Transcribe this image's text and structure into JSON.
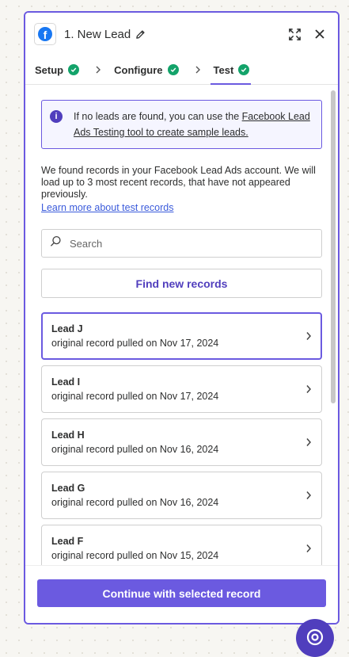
{
  "header": {
    "title": "1. New Lead",
    "app_icon": "facebook-icon",
    "actions": [
      "expand-icon",
      "close-icon"
    ]
  },
  "tabs": [
    {
      "label": "Setup",
      "status": "complete"
    },
    {
      "label": "Configure",
      "status": "complete"
    },
    {
      "label": "Test",
      "status": "complete",
      "active": true
    }
  ],
  "info": {
    "text": "If no leads are found, you can use the ",
    "link": "Facebook Lead Ads Testing tool to create sample leads."
  },
  "description": "We found records in your Facebook Lead Ads account. We will load up to 3 most recent records, that have not appeared previously.",
  "learn_more": "Learn more about test records",
  "search": {
    "placeholder": "Search",
    "value": ""
  },
  "find_button": "Find new records",
  "records": [
    {
      "name": "Lead J",
      "detail": "original record pulled on Nov 17, 2024",
      "selected": true
    },
    {
      "name": "Lead I",
      "detail": "original record pulled on Nov 17, 2024"
    },
    {
      "name": "Lead H",
      "detail": "original record pulled on Nov 16, 2024"
    },
    {
      "name": "Lead G",
      "detail": "original record pulled on Nov 16, 2024"
    },
    {
      "name": "Lead F",
      "detail": "original record pulled on Nov 15, 2024"
    }
  ],
  "footer": {
    "continue_label": "Continue with selected record"
  },
  "colors": {
    "accent": "#6b5ae0",
    "accent_dark": "#503ebd",
    "success": "#13a36a",
    "facebook": "#1877f2"
  }
}
